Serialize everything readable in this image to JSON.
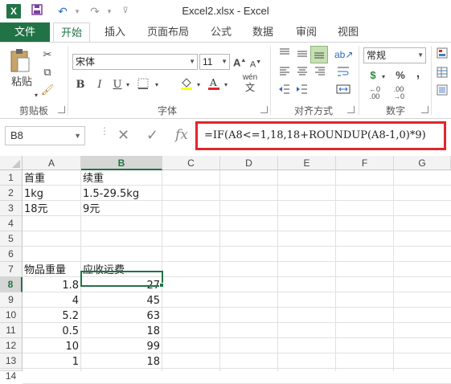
{
  "titlebar": {
    "title": "Excel2.xlsx - Excel",
    "logo": "X"
  },
  "tabs": {
    "file": "文件",
    "items": [
      "开始",
      "插入",
      "页面布局",
      "公式",
      "数据",
      "审阅",
      "视图"
    ],
    "active": "开始"
  },
  "ribbon": {
    "clipboard": {
      "paste_label": "粘贴",
      "group_label": "剪贴板"
    },
    "font": {
      "name": "宋体",
      "size": "11",
      "bold": "B",
      "italic": "I",
      "underline": "U",
      "grow": "A",
      "shrink": "A",
      "wen": "wén",
      "group_label": "字体"
    },
    "alignment": {
      "group_label": "对齐方式"
    },
    "number": {
      "format": "常规",
      "currency": "$",
      "percent": "%",
      "comma": ",",
      "group_label": "数字"
    }
  },
  "formula_bar": {
    "name_box": "B8",
    "cancel_icon": "✕",
    "enter_icon": "✓",
    "fx_label": "fx",
    "formula": "=IF(A8<=1,18,18+ROUNDUP(A8-1,0)*9)"
  },
  "grid": {
    "columns": [
      "A",
      "B",
      "C",
      "D",
      "E",
      "F",
      "G"
    ],
    "selected_column": "B",
    "selected_row": "8",
    "rows": [
      {
        "num": "1",
        "A": "首重",
        "B": "续重"
      },
      {
        "num": "2",
        "A": "1kg",
        "B": "1.5-29.5kg"
      },
      {
        "num": "3",
        "A": "18元",
        "B": "9元"
      },
      {
        "num": "4",
        "A": "",
        "B": ""
      },
      {
        "num": "5",
        "A": "",
        "B": ""
      },
      {
        "num": "6",
        "A": "",
        "B": ""
      },
      {
        "num": "7",
        "A": "物品重量",
        "B": "应收运费"
      },
      {
        "num": "8",
        "A": "1.8",
        "B": "27"
      },
      {
        "num": "9",
        "A": "4",
        "B": "45"
      },
      {
        "num": "10",
        "A": "5.2",
        "B": "63"
      },
      {
        "num": "11",
        "A": "0.5",
        "B": "18"
      },
      {
        "num": "12",
        "A": "10",
        "B": "99"
      },
      {
        "num": "13",
        "A": "1",
        "B": "18"
      },
      {
        "num": "14",
        "A": "",
        "B": ""
      }
    ]
  }
}
